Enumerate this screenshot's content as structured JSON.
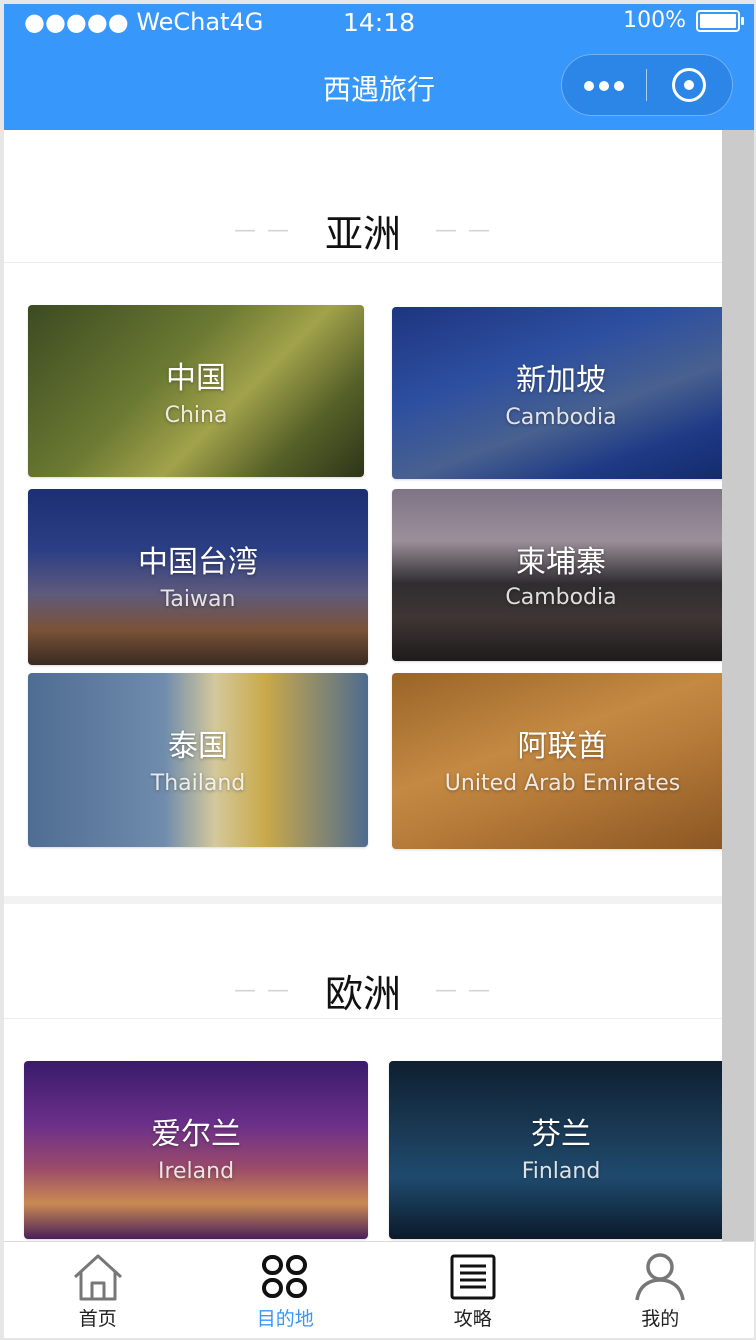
{
  "status_bar": {
    "carrier": "●●●●● WeChat4G",
    "time": "14:18",
    "battery": "100%",
    "battery_level": 1.0
  },
  "nav": {
    "title": "西遇旅行",
    "more_icon": "more-dots-icon",
    "close_icon": "target-circle-icon"
  },
  "sections": [
    {
      "title": "亚洲",
      "cards": [
        {
          "cn": "中国",
          "en": "China"
        },
        {
          "cn": "新加坡",
          "en": "Cambodia"
        },
        {
          "cn": "中国台湾",
          "en": "Taiwan"
        },
        {
          "cn": "柬埔寨",
          "en": "Cambodia"
        },
        {
          "cn": "泰国",
          "en": "Thailand"
        },
        {
          "cn": "阿联酋",
          "en": "United Arab Emirates"
        }
      ]
    },
    {
      "title": "欧洲",
      "cards": [
        {
          "cn": "爱尔兰",
          "en": "Ireland"
        },
        {
          "cn": "芬兰",
          "en": "Finland"
        }
      ]
    }
  ],
  "tabbar": {
    "items": [
      {
        "label": "首页",
        "icon": "home-icon"
      },
      {
        "label": "目的地",
        "icon": "grid-icon",
        "active": true
      },
      {
        "label": "攻略",
        "icon": "document-icon"
      },
      {
        "label": "我的",
        "icon": "user-icon"
      }
    ]
  },
  "colors": {
    "accent": "#3797fb",
    "nav_bg": "#3797fb"
  }
}
